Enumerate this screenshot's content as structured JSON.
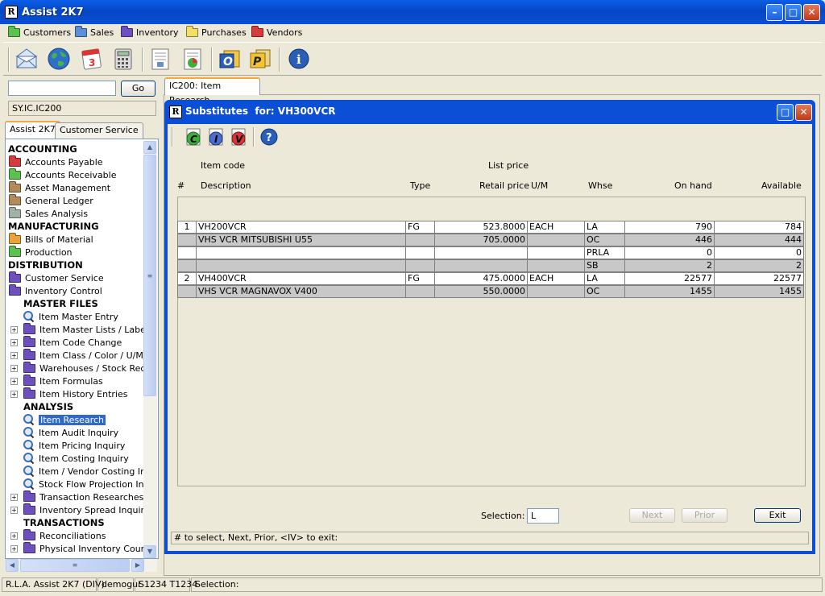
{
  "app": {
    "title": "Assist 2K7"
  },
  "menu": {
    "items": [
      {
        "label": "Customers",
        "color": "#5bc24e"
      },
      {
        "label": "Sales",
        "color": "#5b8fd8"
      },
      {
        "label": "Inventory",
        "color": "#6e4fc0"
      },
      {
        "label": "Purchases",
        "color": "#f2df66"
      },
      {
        "label": "Vendors",
        "color": "#d73c3c"
      }
    ]
  },
  "toolbar": {
    "icons": [
      "mail-icon",
      "globe-icon",
      "calendar-icon",
      "calculator-icon",
      "report-icon",
      "chart-report-icon",
      "outlook-icon",
      "p-icon",
      "info-icon"
    ],
    "calendar_text": "3",
    "o_text": "O",
    "p_text": "P",
    "info_text": "i"
  },
  "sidebar": {
    "go_label": "Go",
    "search_value": "",
    "program_code": "SY.IC.IC200",
    "tabs": [
      "Assist 2K7",
      "Customer Service"
    ],
    "tree": [
      {
        "label": "ACCOUNTING",
        "kind": "header"
      },
      {
        "label": "Accounts Payable",
        "kind": "folder",
        "color": "#d73c3c"
      },
      {
        "label": "Accounts Receivable",
        "kind": "folder",
        "color": "#5bc24e"
      },
      {
        "label": "Asset Management",
        "kind": "folder",
        "color": "#b58a5a"
      },
      {
        "label": "General Ledger",
        "kind": "folder",
        "color": "#b58a5a"
      },
      {
        "label": "Sales Analysis",
        "kind": "folder",
        "color": "#9fb2a6"
      },
      {
        "label": "MANUFACTURING",
        "kind": "header"
      },
      {
        "label": "Bills of Material",
        "kind": "folder",
        "color": "#eaa23a"
      },
      {
        "label": "Production",
        "kind": "folder",
        "color": "#5bc24e"
      },
      {
        "label": "DISTRIBUTION",
        "kind": "header"
      },
      {
        "label": "Customer Service",
        "kind": "folder",
        "color": "#6e4fc0"
      },
      {
        "label": "Inventory Control",
        "kind": "folder",
        "color": "#6e4fc0"
      },
      {
        "label": "MASTER FILES",
        "kind": "subheader"
      },
      {
        "label": "Item Master Entry",
        "kind": "item"
      },
      {
        "label": "Item Master Lists / Labels",
        "kind": "subfolder"
      },
      {
        "label": "Item Code Change",
        "kind": "subfolder"
      },
      {
        "label": "Item Class / Color / U/M",
        "kind": "subfolder"
      },
      {
        "label": "Warehouses / Stock Reque",
        "kind": "subfolder"
      },
      {
        "label": "Item Formulas",
        "kind": "subfolder"
      },
      {
        "label": "Item History Entries",
        "kind": "subfolder"
      },
      {
        "label": "ANALYSIS",
        "kind": "subheader"
      },
      {
        "label": "Item Research",
        "kind": "mag",
        "selected": true
      },
      {
        "label": "Item Audit Inquiry",
        "kind": "mag"
      },
      {
        "label": "Item Pricing Inquiry",
        "kind": "mag"
      },
      {
        "label": "Item Costing Inquiry",
        "kind": "mag"
      },
      {
        "label": "Item / Vendor Costing Inqu",
        "kind": "mag"
      },
      {
        "label": "Stock Flow Projection Inqui",
        "kind": "mag"
      },
      {
        "label": "Transaction Researches",
        "kind": "subfolder"
      },
      {
        "label": "Inventory Spread Inquiries",
        "kind": "subfolder"
      },
      {
        "label": "TRANSACTIONS",
        "kind": "subheader"
      },
      {
        "label": "Reconciliations",
        "kind": "subfolder"
      },
      {
        "label": "Physical Inventory Count",
        "kind": "subfolder"
      }
    ]
  },
  "tab": {
    "label": "IC200: Item Research"
  },
  "dialog": {
    "title": "Substitutes  for: VH300VCR",
    "tool_letters": [
      "C",
      "I",
      "V",
      "?"
    ],
    "headers": {
      "item_code": "Item code",
      "list_price": "List price",
      "num": "#",
      "description": "Description",
      "type": "Type",
      "retail_price": "Retail price",
      "um": "U/M",
      "whse": "Whse",
      "on_hand": "On hand",
      "available": "Available"
    },
    "rows": [
      {
        "num": "1",
        "code": "VH200VCR",
        "type": "FG",
        "price": "523.8000",
        "um": "EACH",
        "whse": "LA",
        "onhand": "790",
        "avail": "784",
        "style": "white"
      },
      {
        "num": "",
        "code": "VHS VCR MITSUBISHI U55",
        "type": "",
        "price": "705.0000",
        "um": "",
        "whse": "OC",
        "onhand": "446",
        "avail": "444",
        "style": "shade"
      },
      {
        "num": "",
        "code": "",
        "type": "",
        "price": "",
        "um": "",
        "whse": "PRLA",
        "onhand": "0",
        "avail": "0",
        "style": "white"
      },
      {
        "num": "",
        "code": "",
        "type": "",
        "price": "",
        "um": "",
        "whse": "SB",
        "onhand": "2",
        "avail": "2",
        "style": "shade"
      },
      {
        "num": "2",
        "code": "VH400VCR",
        "type": "FG",
        "price": "475.0000",
        "um": "EACH",
        "whse": "LA",
        "onhand": "22577",
        "avail": "22577",
        "style": "white"
      },
      {
        "num": "",
        "code": "VHS VCR MAGNAVOX V400",
        "type": "",
        "price": "550.0000",
        "um": "",
        "whse": "OC",
        "onhand": "1455",
        "avail": "1455",
        "style": "shade"
      }
    ],
    "selection_label": "Selection:",
    "selection_value": "L",
    "next_label": "Next",
    "prior_label": "Prior",
    "exit_label": "Exit",
    "message": "# to select,  Next,  Prior,  <IV> to exit:"
  },
  "status": {
    "app": "R.L.A. Assist 2K7 (DIV)",
    "user": "demogui",
    "session": "S1234 T1234",
    "selection": "Selection:"
  }
}
